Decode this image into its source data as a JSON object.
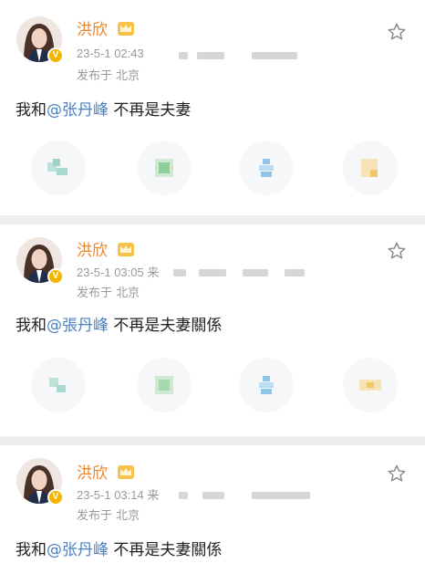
{
  "posts": [
    {
      "username": "洪欣",
      "time": "23-5-1 02:43",
      "source": "发布于 北京",
      "content": {
        "prefix": "我和",
        "mention": "@张丹峰",
        "suffix": " 不再是夫妻"
      }
    },
    {
      "username": "洪欣",
      "time": "23-5-1 03:05",
      "time_extra": "来",
      "source": "发布于 北京",
      "content": {
        "prefix": "我和",
        "mention": "@張丹峰",
        "suffix": " 不再是夫妻關係"
      }
    },
    {
      "username": "洪欣",
      "time": "23-5-1 03:14",
      "time_extra": "来",
      "source": "发布于 北京",
      "content": {
        "prefix": "我和",
        "mention": "@张丹峰",
        "suffix": " 不再是夫妻關係"
      }
    }
  ],
  "colors": {
    "username": "#e9872b",
    "mention": "#4a7fc1",
    "meta": "#999999",
    "badge": "#f4b400"
  },
  "icons": [
    "crown-icon",
    "star-icon",
    "verified-badge-icon",
    "action-icon-1",
    "action-icon-2",
    "action-icon-3",
    "action-icon-4"
  ]
}
